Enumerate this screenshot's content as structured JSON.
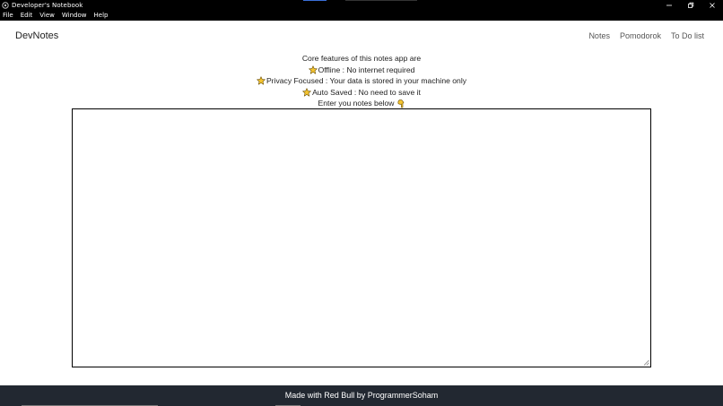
{
  "window": {
    "title": "Developer's Notebook",
    "controls": {
      "minimize_icon": "minimize-icon",
      "maximize_icon": "restore-icon",
      "close_icon": "close-icon"
    }
  },
  "menubar": {
    "items": [
      "File",
      "Edit",
      "View",
      "Window",
      "Help"
    ]
  },
  "nav": {
    "brand": "DevNotes",
    "links": [
      "Notes",
      "Pomodorok",
      "To Do list"
    ]
  },
  "features": {
    "heading": "Core features of this notes app are",
    "items": [
      "Offline : No internet required",
      "Privacy Focused : Your data is stored in your machine only",
      "Auto Saved : No need to save it"
    ],
    "prompt": "Enter you notes below",
    "bullet_icon": "star-icon",
    "prompt_icon": "pointing-down-hand-icon"
  },
  "notes": {
    "value": ""
  },
  "footer": {
    "text": "Made with Red Bull by ProgrammerSoham",
    "background": "#222831"
  },
  "colors": {
    "titlebar": "#000000",
    "star": "#f4c430",
    "text": "#222222"
  }
}
